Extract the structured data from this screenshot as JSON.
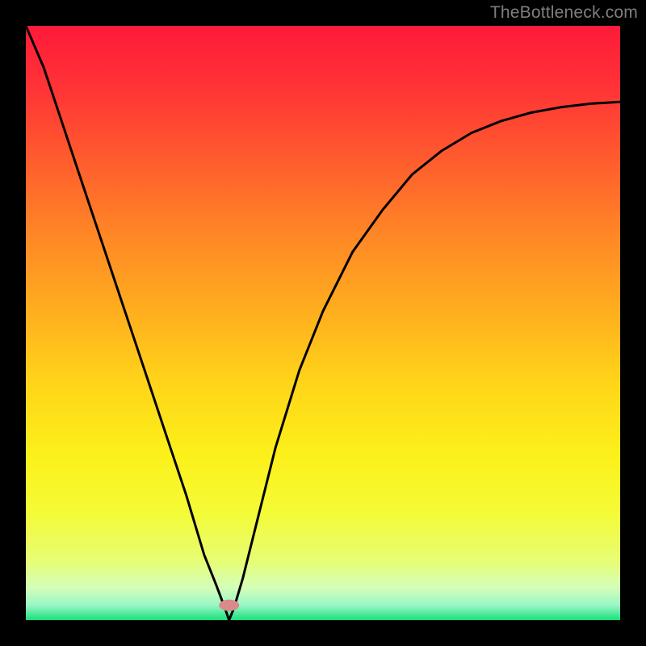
{
  "watermark": "TheBottleneck.com",
  "gradient_stops": [
    {
      "offset": 0.0,
      "color": "#ff1a3a"
    },
    {
      "offset": 0.1,
      "color": "#ff3236"
    },
    {
      "offset": 0.22,
      "color": "#ff5a2e"
    },
    {
      "offset": 0.35,
      "color": "#ff8626"
    },
    {
      "offset": 0.48,
      "color": "#ffae1e"
    },
    {
      "offset": 0.6,
      "color": "#ffd419"
    },
    {
      "offset": 0.72,
      "color": "#fcf01a"
    },
    {
      "offset": 0.82,
      "color": "#f4fb37"
    },
    {
      "offset": 0.9,
      "color": "#e7fd74"
    },
    {
      "offset": 0.945,
      "color": "#d4feb8"
    },
    {
      "offset": 0.975,
      "color": "#9af6c6"
    },
    {
      "offset": 1.0,
      "color": "#16e07a"
    }
  ],
  "marker": {
    "x_frac": 0.342,
    "y_frac": 0.975,
    "rx_frac": 0.017,
    "ry_frac": 0.0095,
    "fill": "#d98a8a"
  },
  "curve": {
    "stroke": "#000000",
    "stroke_width": 3
  },
  "chart_data": {
    "type": "line",
    "title": "",
    "xlabel": "",
    "ylabel": "",
    "x_range": [
      0,
      1
    ],
    "y_range": [
      0,
      1
    ],
    "note": "Axes are unlabeled in the image; values are normalized fractions of the plot area. The curve is a V-shaped profile with its minimum near x≈0.34, y≈0.",
    "series": [
      {
        "name": "curve",
        "x": [
          0.0,
          0.03,
          0.06,
          0.09,
          0.12,
          0.15,
          0.18,
          0.21,
          0.24,
          0.27,
          0.3,
          0.32,
          0.335,
          0.342,
          0.35,
          0.365,
          0.39,
          0.42,
          0.46,
          0.5,
          0.55,
          0.6,
          0.65,
          0.7,
          0.75,
          0.8,
          0.85,
          0.9,
          0.95,
          1.0
        ],
        "y": [
          1.0,
          0.93,
          0.84,
          0.75,
          0.66,
          0.57,
          0.48,
          0.39,
          0.3,
          0.21,
          0.11,
          0.06,
          0.02,
          0.0,
          0.02,
          0.07,
          0.17,
          0.29,
          0.42,
          0.52,
          0.62,
          0.69,
          0.75,
          0.79,
          0.82,
          0.84,
          0.854,
          0.863,
          0.869,
          0.872
        ]
      }
    ],
    "annotations": [
      {
        "type": "marker",
        "x": 0.342,
        "y": 0.025,
        "label": ""
      }
    ]
  }
}
